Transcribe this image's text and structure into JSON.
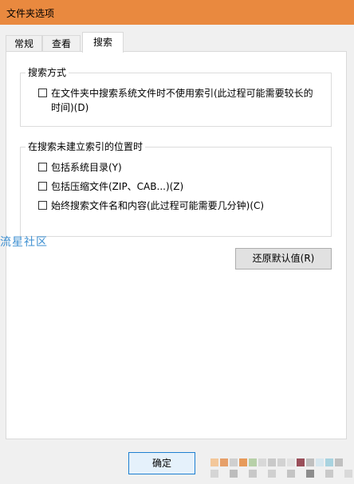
{
  "window": {
    "title": "文件夹选项"
  },
  "tabs": [
    {
      "label": "常规"
    },
    {
      "label": "查看"
    },
    {
      "label": "搜索"
    }
  ],
  "active_tab": "搜索",
  "search_mode": {
    "label": "搜索方式",
    "options": [
      {
        "label": "在文件夹中搜索系统文件时不使用索引(此过程可能需要较长的时间)(D)",
        "checked": false
      }
    ]
  },
  "non_indexed": {
    "label": "在搜索未建立索引的位置时",
    "options": [
      {
        "label": "包括系统目录(Y)",
        "checked": false
      },
      {
        "label": "包括压缩文件(ZIP、CAB...)(Z)",
        "checked": false
      },
      {
        "label": "始终搜索文件名和内容(此过程可能需要几分钟)(C)",
        "checked": false
      }
    ]
  },
  "buttons": {
    "restore_defaults": "还原默认值(R)",
    "ok": "确定"
  },
  "watermark": "流星社区",
  "colors": {
    "titlebar": "#e9893f",
    "watermark": "#3d8fd1",
    "default_button_border": "#1d7fd1"
  }
}
